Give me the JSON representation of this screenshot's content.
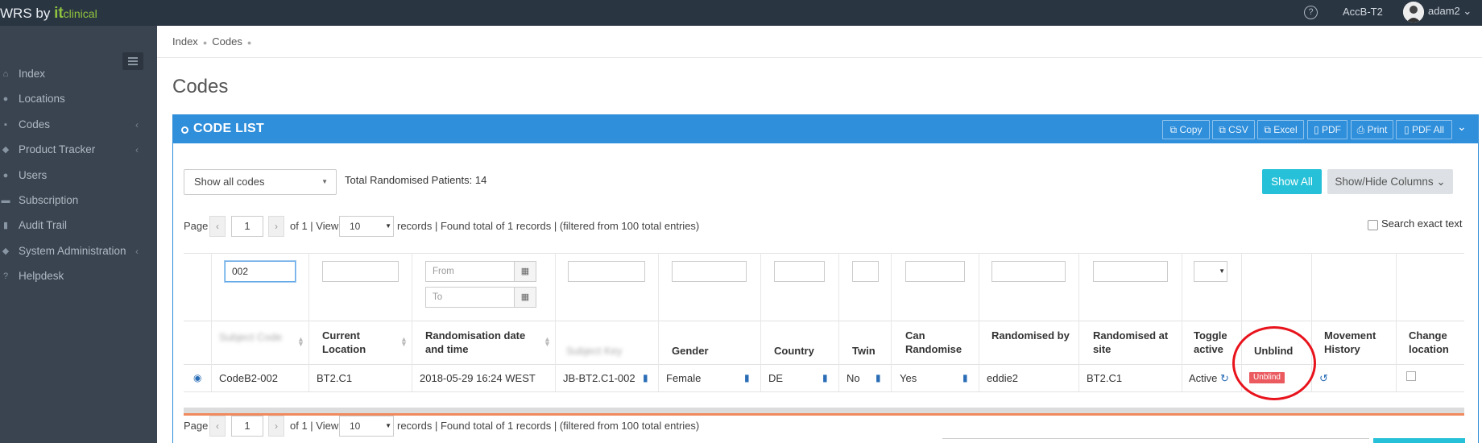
{
  "topbar": {
    "brand_prefix": "WRS by ",
    "brand_it": "it",
    "brand_clinical": "clinical",
    "account": "AccB-T2",
    "user": "adam2 ⌄"
  },
  "sidebar": {
    "items": [
      {
        "label": "Index",
        "icon": "home-icon"
      },
      {
        "label": "Locations",
        "icon": "globe-icon"
      },
      {
        "label": "Codes",
        "icon": "code-icon",
        "has_submenu": true
      },
      {
        "label": "Product Tracker",
        "icon": "map-marker-icon",
        "has_submenu": true
      },
      {
        "label": "Users",
        "icon": "users-icon"
      },
      {
        "label": "Subscription",
        "icon": "card-icon"
      },
      {
        "label": "Audit Trail",
        "icon": "book-icon"
      },
      {
        "label": "System Administration",
        "icon": "shield-icon",
        "has_submenu": true
      },
      {
        "label": "Helpdesk",
        "icon": "question-icon"
      }
    ]
  },
  "breadcrumb": [
    "Index",
    "Codes"
  ],
  "page": {
    "title": "Codes"
  },
  "panel": {
    "title": "CODE LIST",
    "export_buttons": [
      "Copy",
      "CSV",
      "Excel",
      "PDF",
      "Print",
      "PDF All"
    ]
  },
  "controls": {
    "filter_value": "Show all codes",
    "total_patients": "Total Randomised Patients: 14",
    "show_all": "Show All",
    "show_hide_columns": "Show/Hide Columns ⌄",
    "search_exact": "Search exact text"
  },
  "pager": {
    "page_label": "Page",
    "page_number": "1",
    "of_text": "of 1 | View",
    "view_count": "10",
    "records_text": "records | Found total of 1 records |  (filtered from 100 total entries)"
  },
  "filters": {
    "code_value": "002",
    "date_from_placeholder": "From",
    "date_to_placeholder": "To"
  },
  "columns": [
    "Subject Code",
    "Current Location",
    "Randomisation date and time",
    "Subject Key",
    "Gender",
    "Country",
    "Twin",
    "Can Randomise",
    "Randomised by",
    "Randomised at site",
    "Toggle active",
    "Unblind",
    "Movement History",
    "Change location"
  ],
  "row": {
    "code": "CodeB2-002",
    "location": "BT2.C1",
    "rand_date": "2018-05-29 16:24 WEST",
    "subject_key": "JB-BT2.C1-002",
    "gender": "Female",
    "country": "DE",
    "twin": "No",
    "can_randomise": "Yes",
    "randomised_by": "eddie2",
    "randomised_site": "BT2.C1",
    "active": "Active",
    "unblind": "Unblind"
  },
  "colors": {
    "topbar": "#2a3542",
    "sidebar": "#3a4450",
    "panel_header": "#2f8fdb",
    "accent_teal": "#26c1d8",
    "unblind_red": "#ea5a5f",
    "highlight_circle": "#e8131c"
  }
}
